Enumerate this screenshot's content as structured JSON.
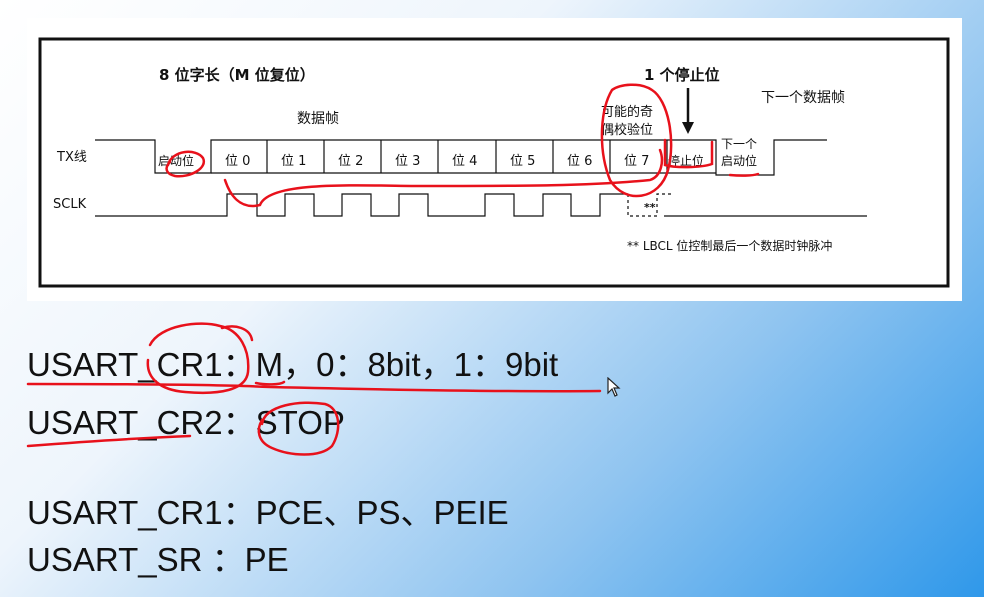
{
  "diagram": {
    "title_word_length": "8 位字长（M 位复位）",
    "data_frame_label": "数据帧",
    "stop_bit_title": "1 个停止位",
    "next_frame_label": "下一个数据帧",
    "parity_label_line1": "可能的奇",
    "parity_label_line2": "偶校验位",
    "signal_tx": "TX线",
    "signal_sclk": "SCLK",
    "start_bit": "启动位",
    "bits": [
      "位 0",
      "位 1",
      "位 2",
      "位 3",
      "位 4",
      "位 5",
      "位 6",
      "位 7"
    ],
    "stop_bit": "停止位",
    "next_start_line1": "下一个",
    "next_start_line2": "启动位",
    "stars": "**",
    "footnote": "** LBCL 位控制最后一个数据时钟脉冲"
  },
  "registers": [
    "USART_CR1：M，0：8bit，1：9bit",
    "USART_CR2：STOP",
    "USART_CR1：PCE、PS、PEIE",
    "USART_SR  ：PE"
  ],
  "annotation_color": "#e8111b",
  "cursor_icon": "mouse-pointer-icon"
}
